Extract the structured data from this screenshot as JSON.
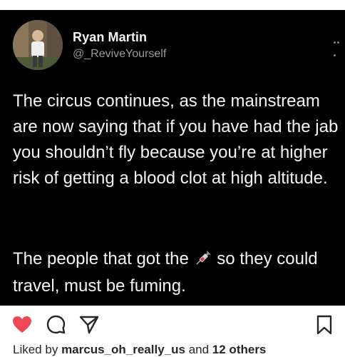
{
  "post": {
    "author_name": "Ryan Martin",
    "author_handle": "@_ReviveYourself",
    "paragraph1": "The circus continues, as the mainstream are now saying that if you have had the jab you shouldn’t fly because you’re at higher risk of getting a blood clot at high altitude.",
    "paragraph2_before": "The people that got the",
    "paragraph2_emoji": "syringe-icon",
    "paragraph2_after": "so they could travel, must be fuming.",
    "more_icon": "more-horizontal-icon"
  },
  "actions": {
    "like_icon": "heart-icon",
    "like_color": "#ed4956",
    "comment_icon": "comment-icon",
    "share_icon": "send-icon",
    "save_icon": "bookmark-icon"
  },
  "likes": {
    "prefix": "Liked by",
    "user": "marcus_oh_really_us",
    "joiner": "and",
    "others": "12 others"
  }
}
